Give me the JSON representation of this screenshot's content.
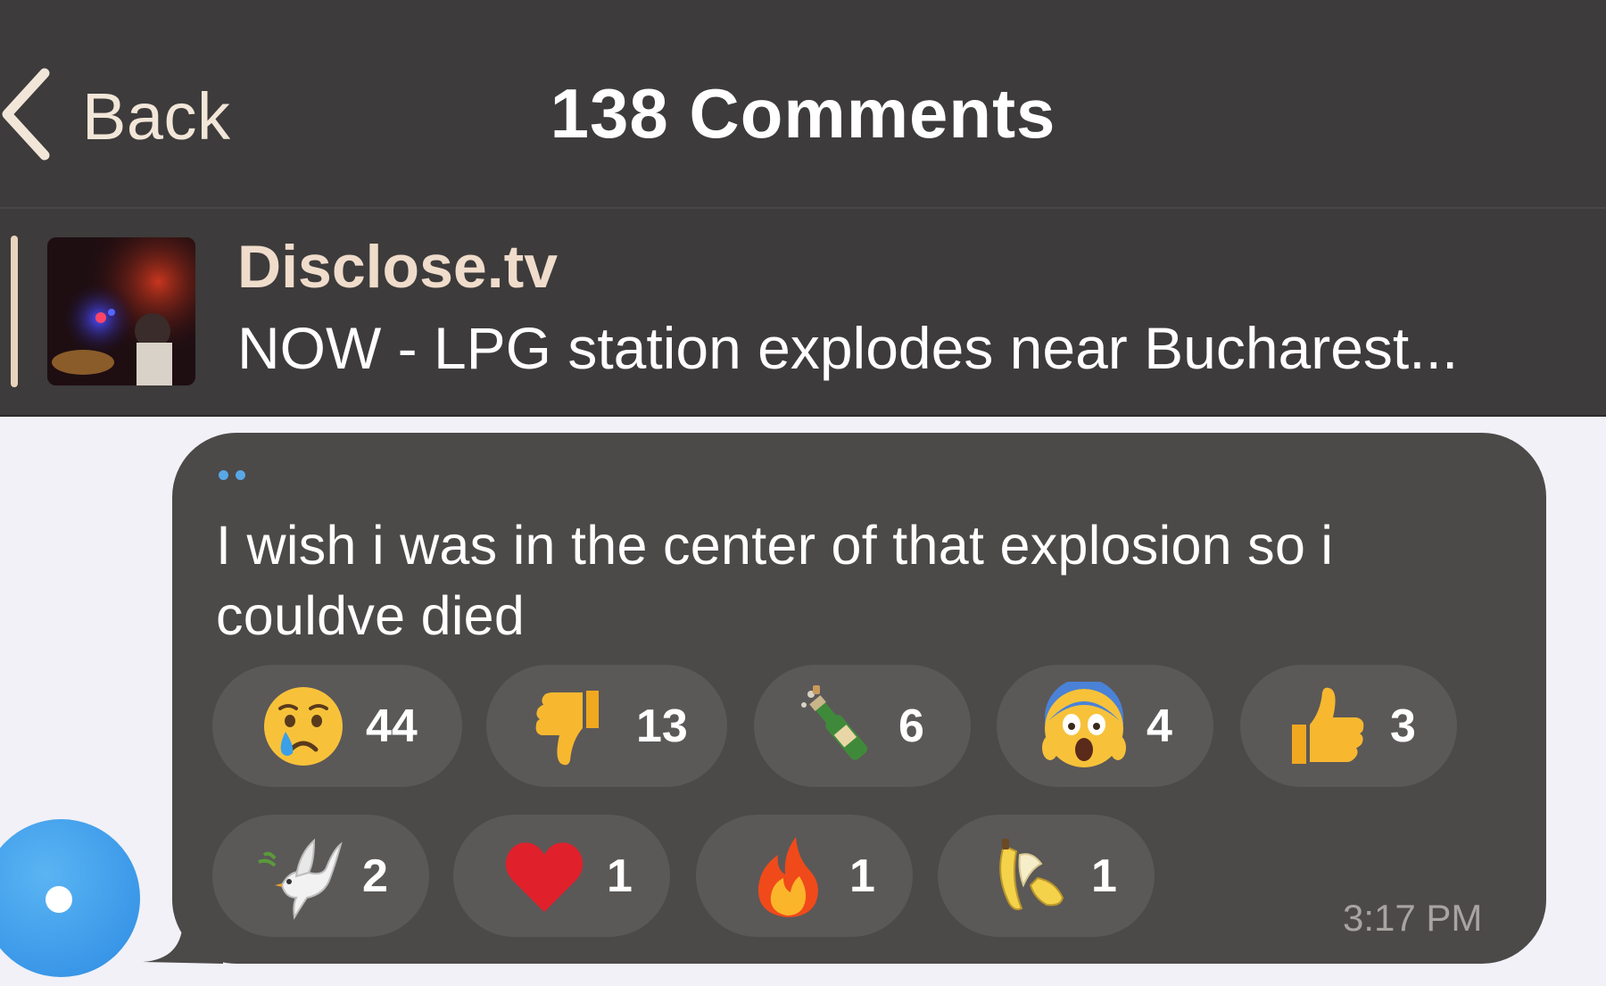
{
  "header": {
    "back_label": "Back",
    "title": "138 Comments"
  },
  "pinned": {
    "channel": "Disclose.tv",
    "text": "NOW - LPG station explodes near Bucharest..."
  },
  "message": {
    "text": "I wish i was in the center of that explosion so i couldve died",
    "time": "3:17 PM",
    "reactions": [
      {
        "emoji": "crying-face",
        "count": "44"
      },
      {
        "emoji": "thumbs-down",
        "count": "13"
      },
      {
        "emoji": "champagne-bottle",
        "count": "6"
      },
      {
        "emoji": "screaming-face",
        "count": "4"
      },
      {
        "emoji": "thumbs-up",
        "count": "3"
      },
      {
        "emoji": "dove",
        "count": "2"
      },
      {
        "emoji": "red-heart",
        "count": "1"
      },
      {
        "emoji": "fire",
        "count": "1"
      },
      {
        "emoji": "banana",
        "count": "1"
      }
    ]
  },
  "colors": {
    "header_bg": "#3d3b3b",
    "bubble_bg": "#4c4949",
    "reaction_bg": "#5b5858",
    "accent_beige": "#f0dccb",
    "avatar_blue": "#3b98e8",
    "page_bg": "#f1f1f7"
  }
}
